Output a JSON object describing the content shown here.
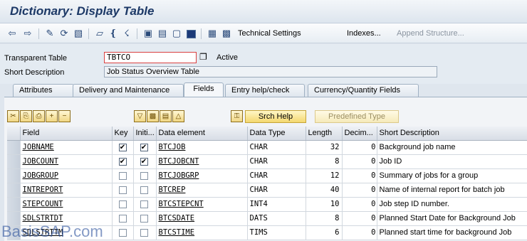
{
  "title": "Dictionary: Display Table",
  "toolbar": {
    "technical_settings": "Technical Settings",
    "indexes": "Indexes...",
    "append_structure": "Append Structure..."
  },
  "header": {
    "transparent_table_label": "Transparent Table",
    "table_name": "TBTCO",
    "status": "Active",
    "short_description_label": "Short Description",
    "short_description": "Job Status Overview Table"
  },
  "tabs": [
    {
      "label": "Attributes"
    },
    {
      "label": "Delivery and Maintenance"
    },
    {
      "label": "Fields",
      "active": true
    },
    {
      "label": "Entry help/check"
    },
    {
      "label": "Currency/Quantity Fields"
    }
  ],
  "grid_toolbar": {
    "srch_help": "Srch Help",
    "predefined_type": "Predefined Type"
  },
  "columns": [
    "Field",
    "Key",
    "Initi...",
    "Data element",
    "Data Type",
    "Length",
    "Decim...",
    "Short Description"
  ],
  "rows": [
    {
      "field": "JOBNAME",
      "key": true,
      "initial": true,
      "data_element": "BTCJOB",
      "data_type": "CHAR",
      "length": "32",
      "decimals": "0",
      "short_description": "Background job name"
    },
    {
      "field": "JOBCOUNT",
      "key": true,
      "initial": true,
      "data_element": "BTCJOBCNT",
      "data_type": "CHAR",
      "length": "8",
      "decimals": "0",
      "short_description": "Job ID"
    },
    {
      "field": "JOBGROUP",
      "key": false,
      "initial": false,
      "data_element": "BTCJOBGRP",
      "data_type": "CHAR",
      "length": "12",
      "decimals": "0",
      "short_description": "Summary of jobs for a group"
    },
    {
      "field": "INTREPORT",
      "key": false,
      "initial": false,
      "data_element": "BTCREP",
      "data_type": "CHAR",
      "length": "40",
      "decimals": "0",
      "short_description": "Name of internal report for batch job"
    },
    {
      "field": "STEPCOUNT",
      "key": false,
      "initial": false,
      "data_element": "BTCSTEPCNT",
      "data_type": "INT4",
      "length": "10",
      "decimals": "0",
      "short_description": "Job step ID number."
    },
    {
      "field": "SDLSTRTDT",
      "key": false,
      "initial": false,
      "data_element": "BTCSDATE",
      "data_type": "DATS",
      "length": "8",
      "decimals": "0",
      "short_description": "Planned Start Date for Background Job"
    },
    {
      "field": "SDLSTRTTM",
      "key": false,
      "initial": false,
      "data_element": "BTCSTIME",
      "data_type": "TIMS",
      "length": "6",
      "decimals": "0",
      "short_description": "Planned start time for background Job"
    }
  ],
  "watermark": "BasisSAP.com"
}
